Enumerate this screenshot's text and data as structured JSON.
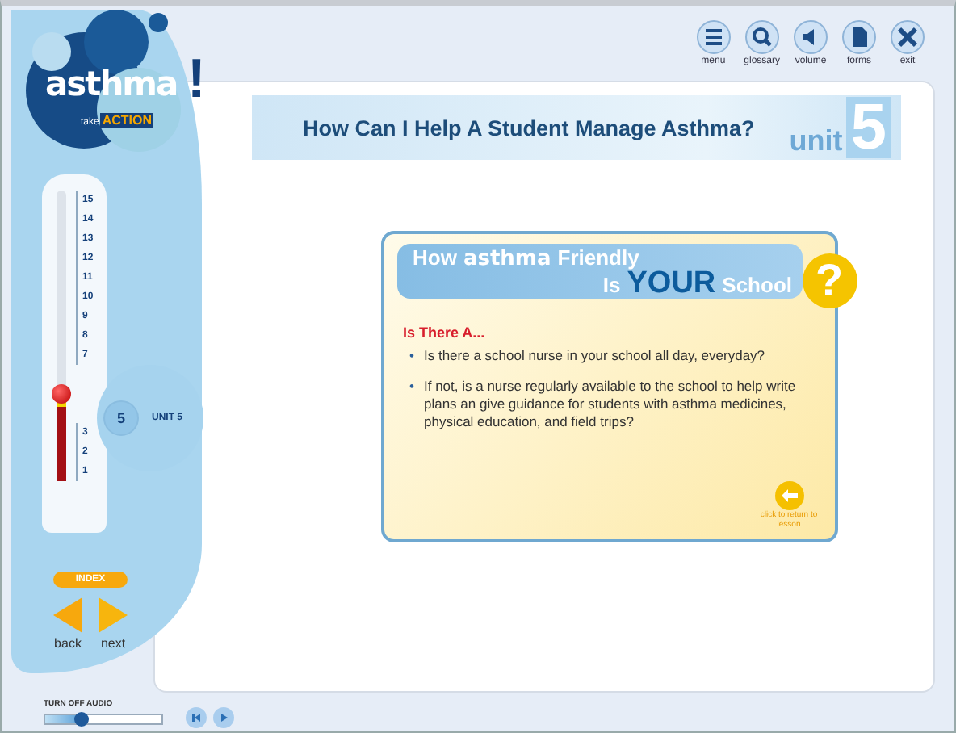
{
  "logo": {
    "word": "asthma",
    "tagline_small": "take",
    "tagline_big": "ACTION",
    "mark": "!"
  },
  "toolbar": [
    {
      "kind": "menu",
      "label": "menu"
    },
    {
      "kind": "search",
      "label": "glossary"
    },
    {
      "kind": "volume",
      "label": "volume"
    },
    {
      "kind": "document",
      "label": "forms"
    },
    {
      "kind": "close",
      "label": "exit"
    }
  ],
  "title": "How Can I Help A Student Manage Asthma?",
  "unit_badge": {
    "word": "unit",
    "number": "5"
  },
  "thermometer": {
    "scale_upper": [
      "15",
      "14",
      "13",
      "12",
      "11",
      "10",
      "9",
      "8",
      "7"
    ],
    "scale_lower": [
      "3",
      "2",
      "1"
    ],
    "level": 0.3,
    "current": {
      "number": "5",
      "label": "UNIT 5"
    }
  },
  "card": {
    "heading_lines": [
      [
        {
          "text": "How",
          "kind": "plain"
        },
        {
          "text": "asthma",
          "kind": "logo"
        },
        {
          "text": "Friendly",
          "kind": "plain"
        }
      ],
      [
        {
          "text": "Is",
          "kind": "plain"
        },
        {
          "text": "YOUR",
          "kind": "big"
        },
        {
          "text": "School",
          "kind": "plain"
        }
      ]
    ],
    "question_mark": "?",
    "subtitle": "Is There A...",
    "bullets": [
      {
        "marker": "•",
        "text": "Is there a school nurse in your school all day, everyday?"
      },
      {
        "marker": "•",
        "text": "If not, is a nurse regularly available to the school to help write plans an give guidance for students with asthma medicines, physical education, and field trips?"
      }
    ],
    "return_label": "click to return to lesson"
  },
  "navigation": {
    "index": "INDEX",
    "back": "back",
    "next": "next"
  },
  "audio": {
    "label": "TURN OFF AUDIO",
    "level": 0.3,
    "buttons": [
      {
        "kind": "rewind"
      },
      {
        "kind": "play"
      }
    ]
  }
}
